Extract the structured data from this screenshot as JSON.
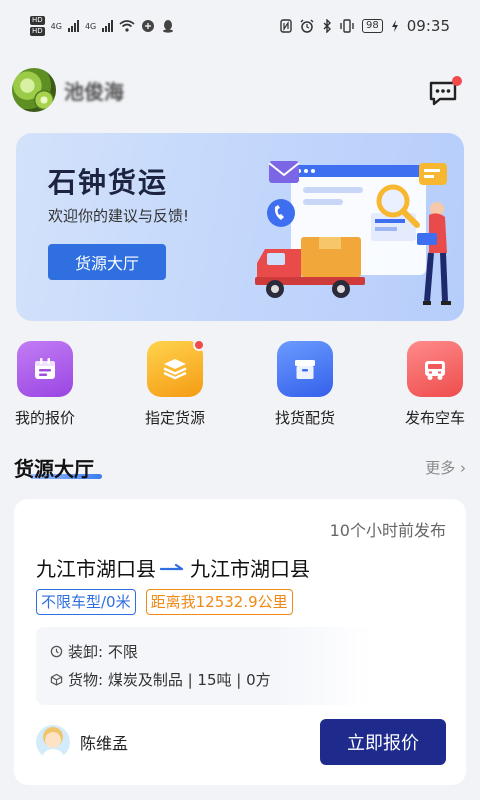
{
  "status_bar": {
    "hd1": "HD",
    "hd2": "HD",
    "net1": "4G",
    "net2": "4G",
    "battery": "98",
    "time": "09:35",
    "icons": [
      "nfc-icon",
      "alarm-icon",
      "bluetooth-icon",
      "vibrate-icon",
      "battery-icon"
    ]
  },
  "user": {
    "name": "池俊海",
    "message_icon": "chat-bubble-icon"
  },
  "banner": {
    "title": "石钟货运",
    "subtitle": "欢迎你的建议与反馈!",
    "button_label": "货源大厅"
  },
  "quick_entries": [
    {
      "label": "我的报价",
      "icon": "calendar-icon",
      "color": "#a14ce0",
      "badge": false
    },
    {
      "label": "指定货源",
      "icon": "layers-icon",
      "color": "#f6a31a",
      "badge": true
    },
    {
      "label": "找货配货",
      "icon": "box-icon",
      "color": "#3d6ff0",
      "badge": false
    },
    {
      "label": "发布空车",
      "icon": "truck-icon",
      "color": "#f15a5a",
      "badge": false
    }
  ],
  "section": {
    "title": "货源大厅",
    "more": "更多 ›"
  },
  "cargo_card": {
    "time": "10个小时前发布",
    "from": "九江市湖口县",
    "to": "九江市湖口县",
    "tag_vehicle": "不限车型/0米",
    "tag_distance": "距离我12532.9公里",
    "loading": "装卸: 不限",
    "goods": "货物: 煤炭及制品 | 15吨 | 0方",
    "contact": "陈维孟",
    "button": "立即报价"
  },
  "colors": {
    "primary": "#2f6fdf",
    "button_dark": "#1e2a8c",
    "orange": "#f08a17",
    "badge_red": "#f04a4a"
  }
}
